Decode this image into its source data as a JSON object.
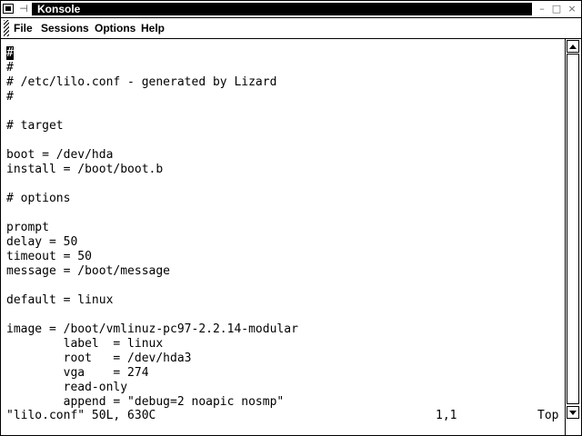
{
  "window": {
    "title": "Konsole",
    "buttons": {
      "minimize": "–",
      "maximize": "□",
      "close": "×"
    }
  },
  "menubar": {
    "items": [
      "File",
      "Sessions",
      "Options",
      "Help"
    ]
  },
  "terminal": {
    "lines": [
      "#",
      "#",
      "# /etc/lilo.conf - generated by Lizard",
      "#",
      "",
      "# target",
      "",
      "boot = /dev/hda",
      "install = /boot/boot.b",
      "",
      "# options",
      "",
      "prompt",
      "delay = 50",
      "timeout = 50",
      "message = /boot/message",
      "",
      "default = linux",
      "",
      "image = /boot/vmlinuz-pc97-2.2.14-modular",
      "        label  = linux",
      "        root   = /dev/hda3",
      "        vga    = 274",
      "        read-only",
      "        append = \"debug=2 noapic nosmp\""
    ],
    "status": {
      "file_info": "\"lilo.conf\" 50L, 630C",
      "cursor_pos": "1,1",
      "scroll": "Top"
    }
  },
  "icons": {
    "system_menu": "window-menu-icon",
    "sticky": "sticky-pin-icon",
    "grip": "toolbar-grip-icon"
  },
  "colors": {
    "title_bar": "#000000",
    "title_text": "#ffffff",
    "background": "#ffffff",
    "text": "#000000"
  }
}
